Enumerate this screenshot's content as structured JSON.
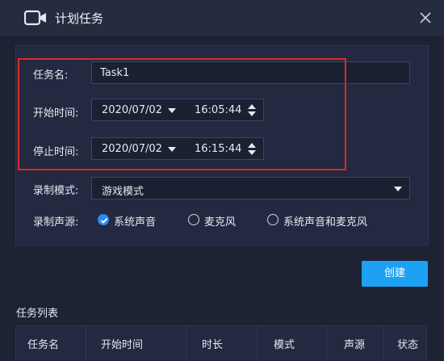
{
  "window": {
    "title": "计划任务",
    "icon": "camera-icon"
  },
  "form": {
    "task_name": {
      "label": "任务名:",
      "value": "Task1"
    },
    "start_time": {
      "label": "开始时间:",
      "date": "2020/07/02",
      "time": "16:05:44"
    },
    "stop_time": {
      "label": "停止时间:",
      "date": "2020/07/02",
      "time": "16:15:44"
    },
    "record_mode": {
      "label": "录制模式:",
      "value": "游戏模式"
    },
    "audio_source": {
      "label": "录制声源:",
      "options": [
        {
          "label": "系统声音",
          "selected": true
        },
        {
          "label": "麦克风",
          "selected": false
        },
        {
          "label": "系统声音和麦克风",
          "selected": false
        }
      ]
    }
  },
  "create_button": "创建",
  "task_list": {
    "title": "任务列表",
    "columns": [
      "任务名",
      "开始时间",
      "时长",
      "模式",
      "声源",
      "状态"
    ]
  },
  "colors": {
    "accent": "#1da1f2",
    "highlight": "#e0262c",
    "background": "#1d2235"
  }
}
